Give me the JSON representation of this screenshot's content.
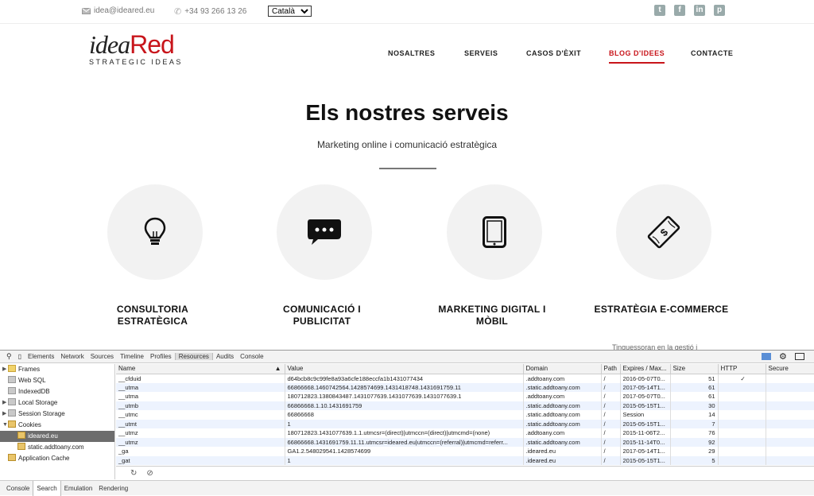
{
  "topbar": {
    "email": "idea@ideared.eu",
    "phone": "+34 93 266 13 26",
    "language": "Català",
    "social_icons": [
      "twitter-icon",
      "facebook-icon",
      "linkedin-icon",
      "pinterest-icon"
    ]
  },
  "logo": {
    "part1": "idea",
    "part2": "Red",
    "tagline": "STRATEGIC IDEAS"
  },
  "nav": {
    "items": [
      "NOSALTRES",
      "SERVEIS",
      "CASOS D'ÈXIT",
      "BLOG D'IDEES",
      "CONTACTE"
    ],
    "active": "BLOG D'IDEES"
  },
  "hero": {
    "title": "Els nostres serveis",
    "subtitle": "Marketing online i comunicació estratègica"
  },
  "services": [
    {
      "line1": "CONSULTORIA",
      "line2": "ESTRATÈGICA",
      "icon": "lightbulb-icon"
    },
    {
      "line1": "COMUNICACIÓ I",
      "line2": "PUBLICITAT",
      "icon": "chat-bubble-icon"
    },
    {
      "line1": "MARKETING DIGITAL I",
      "line2": "MÒBIL",
      "icon": "tablet-icon"
    },
    {
      "line1": "ESTRATÈGIA E-COMMERCE",
      "line2": "",
      "icon": "money-icon"
    }
  ],
  "peek_text": "Tinguessoran en la gestió i",
  "colors": {
    "brand_red": "#c8151b"
  },
  "devtools": {
    "tabs": [
      "Elements",
      "Network",
      "Sources",
      "Timeline",
      "Profiles",
      "Resources",
      "Audits",
      "Console"
    ],
    "active_tab": "Resources",
    "sidebar": [
      "Frames",
      "Web SQL",
      "IndexedDB",
      "Local Storage",
      "Session Storage",
      "Cookies",
      "ideared.eu",
      "static.addtoany.com",
      "Application Cache"
    ],
    "columns": [
      "Name",
      "Value",
      "Domain",
      "Path",
      "Expires / Max...",
      "Size",
      "HTTP",
      "Secure"
    ],
    "rows": [
      [
        "__cfduid",
        "d64bcb8c9c99fe8a93a6cfe188eccfa1b1431077434",
        ".addtoany.com",
        "/",
        "2016-05-07T0...",
        "51",
        "✓",
        ""
      ],
      [
        "__utma",
        "66866668.1460742564.1428574699.1431418748.1431691759.11",
        ".static.addtoany.com",
        "/",
        "2017-05-14T1...",
        "61",
        "",
        ""
      ],
      [
        "__utma",
        "180712823.1380843487.1431077639.1431077639.1431077639.1",
        ".addtoany.com",
        "/",
        "2017-05-07T0...",
        "61",
        "",
        ""
      ],
      [
        "__utmb",
        "66866668.1.10.1431691759",
        ".static.addtoany.com",
        "/",
        "2015-05-15T1...",
        "30",
        "",
        ""
      ],
      [
        "__utmc",
        "66866668",
        ".static.addtoany.com",
        "/",
        "Session",
        "14",
        "",
        ""
      ],
      [
        "__utmt",
        "1",
        ".static.addtoany.com",
        "/",
        "2015-05-15T1...",
        "7",
        "",
        ""
      ],
      [
        "__utmz",
        "180712823.1431077639.1.1.utmcsr=(direct)|utmccn=(direct)|utmcmd=(none)",
        ".addtoany.com",
        "/",
        "2015-11-06T2...",
        "76",
        "",
        ""
      ],
      [
        "__utmz",
        "66866668.1431691759.11.11.utmcsr=ideared.eu|utmccn=(referral)|utmcmd=referr...",
        ".static.addtoany.com",
        "/",
        "2015-11-14T0...",
        "92",
        "",
        ""
      ],
      [
        "_ga",
        "GA1.2.548029541.1428574699",
        ".ideared.eu",
        "/",
        "2017-05-14T1...",
        "29",
        "",
        ""
      ],
      [
        "_gat",
        "1",
        ".ideared.eu",
        "/",
        "2015-05-15T1...",
        "5",
        "",
        ""
      ]
    ],
    "drawer_tabs": [
      "Console",
      "Search",
      "Emulation",
      "Rendering"
    ],
    "drawer_active": "Search"
  }
}
